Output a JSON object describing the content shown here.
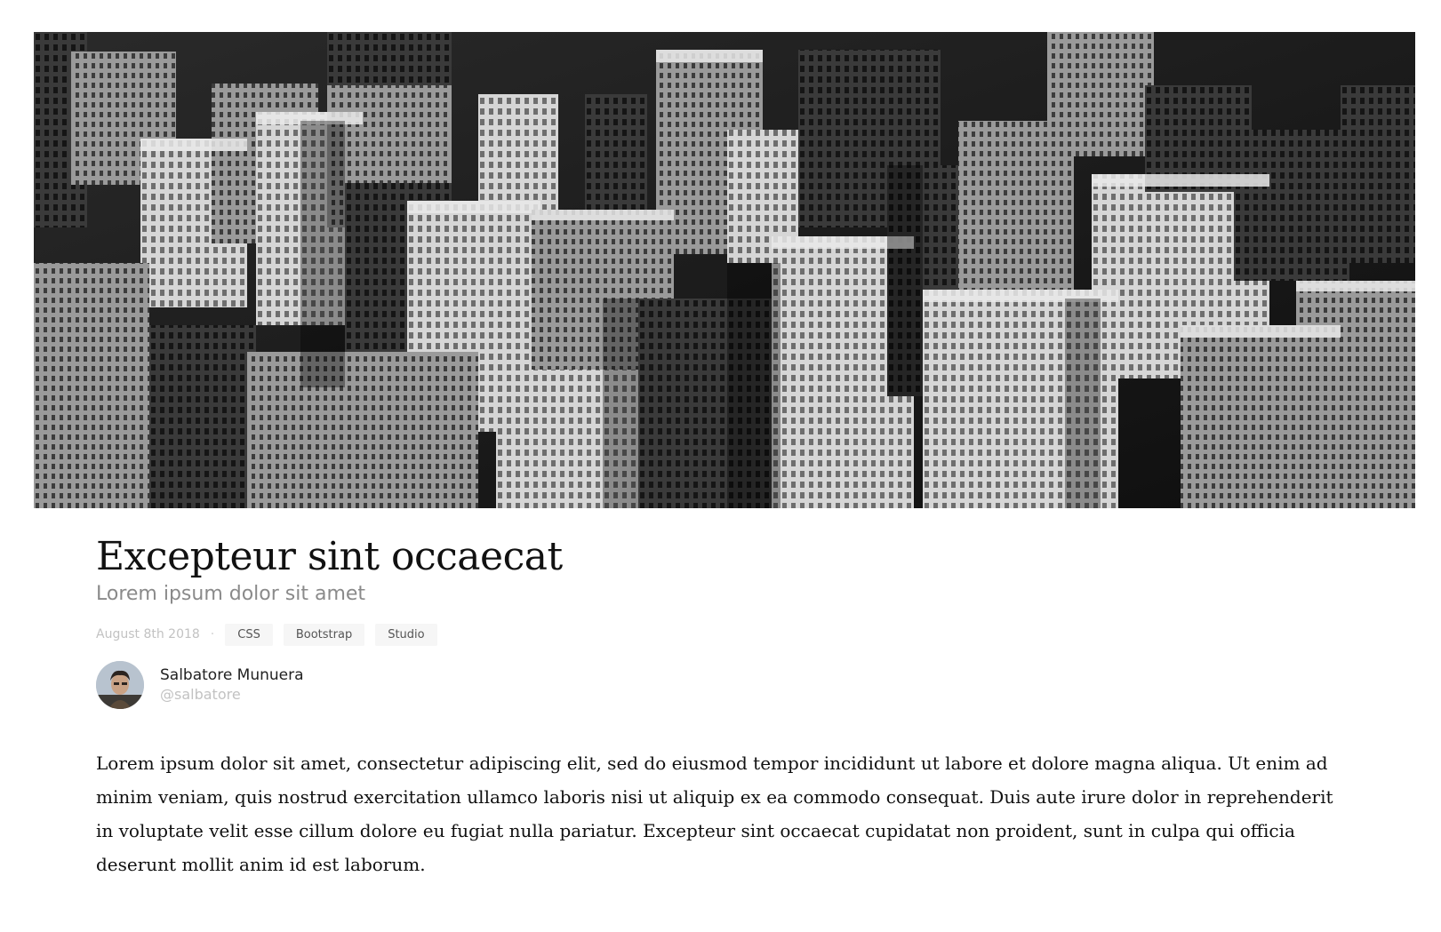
{
  "hero": {
    "image_name": "city-skyline-image",
    "tone": "black-and-white"
  },
  "article": {
    "title": "Excepteur sint occaecat",
    "subtitle": "Lorem ipsum dolor sit amet",
    "date": "August 8th 2018",
    "separator": "·",
    "tags": [
      "CSS",
      "Bootstrap",
      "Studio"
    ],
    "author": {
      "name": "Salbatore Munuera",
      "handle": "@salbatore"
    },
    "body": "Lorem ipsum dolor sit amet, consectetur adipiscing elit, sed do eiusmod tempor incididunt ut labore et dolore magna aliqua. Ut enim ad minim veniam, quis nostrud exercitation ullamco laboris nisi ut aliquip ex ea commodo consequat. Duis aute irure dolor in reprehenderit in voluptate velit esse cillum dolore eu fugiat nulla pariatur. Excepteur sint occaecat cupidatat non proident, sunt in culpa qui officia deserunt mollit anim id est laborum."
  },
  "colors": {
    "title": "#111111",
    "subtitle": "#8a8a8a",
    "muted": "#c2c2c2",
    "tag_bg": "#f6f6f6"
  }
}
